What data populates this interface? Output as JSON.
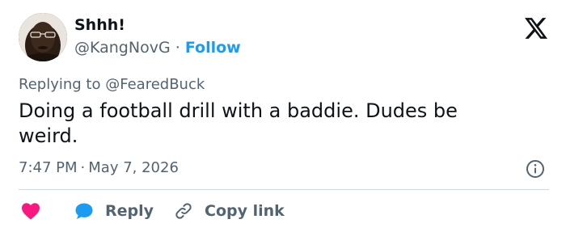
{
  "author": {
    "name": "Shhh!",
    "handle": "@KangNovG",
    "separator": "·",
    "follow_label": "Follow"
  },
  "reply_context": {
    "prefix": "Replying to",
    "mention": "@FearedBuck"
  },
  "tweet": {
    "text": "Doing a football drill with a baddie. Dudes be weird."
  },
  "meta": {
    "time": "7:47 PM",
    "separator": "·",
    "date": "May 7, 2026"
  },
  "actions": {
    "reply_label": "Reply",
    "copy_link_label": "Copy link"
  },
  "icons": {
    "logo": "x-logo-icon",
    "info": "info-icon",
    "like": "heart-icon",
    "reply": "speech-bubble-icon",
    "copy": "link-icon"
  },
  "colors": {
    "accent": "#1d9bf0",
    "like": "#f91880",
    "text": "#0f1419",
    "muted": "#536471",
    "divider": "#cfd9de"
  }
}
